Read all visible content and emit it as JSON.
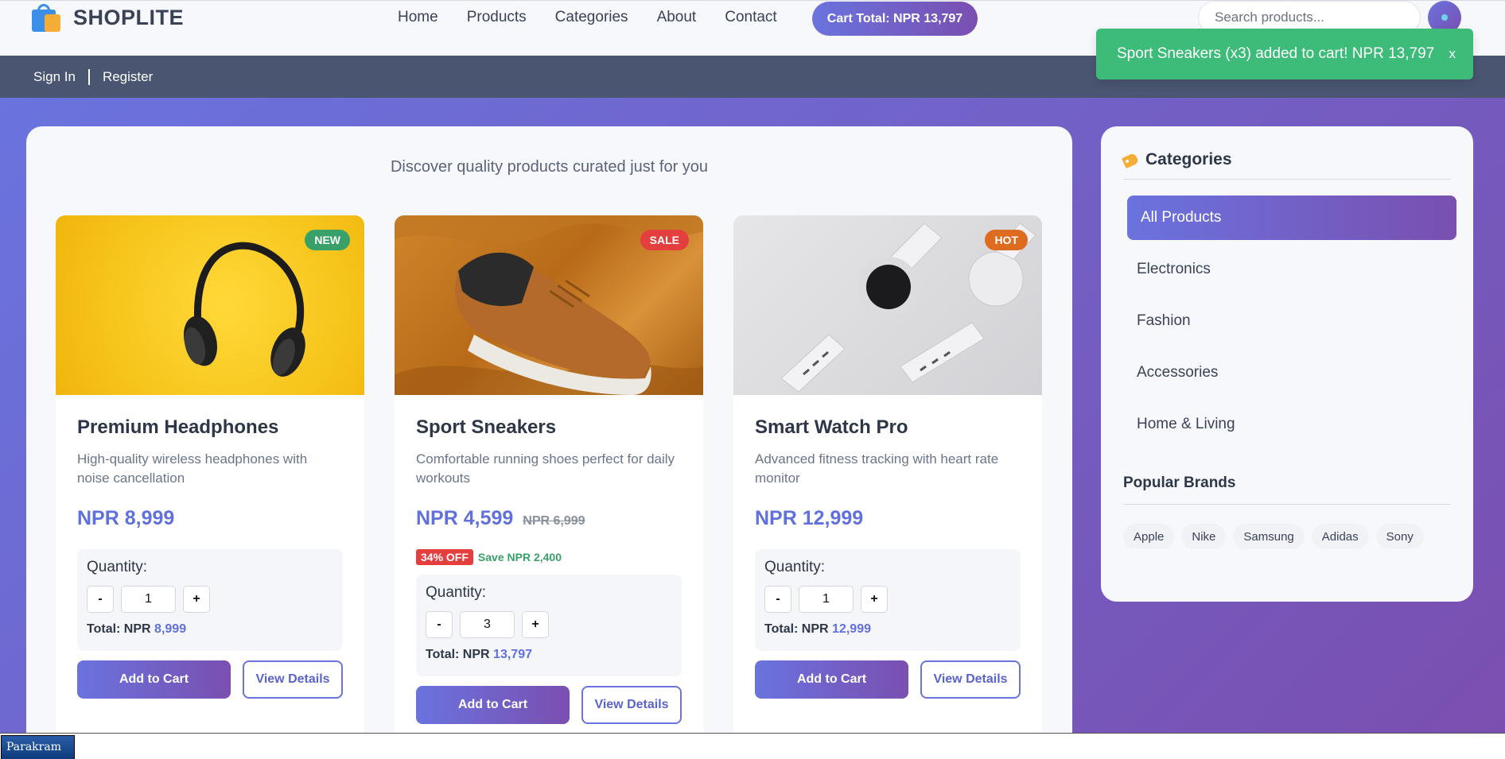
{
  "header": {
    "brand": "SHOPLITE",
    "nav": [
      "Home",
      "Products",
      "Categories",
      "About",
      "Contact"
    ],
    "cart_total": "Cart Total: NPR 13,797",
    "search_placeholder": "Search products..."
  },
  "auth": {
    "sign_in": "Sign In",
    "register": "Register"
  },
  "toast": {
    "message": "Sport Sneakers (x3) added to cart! NPR 13,797",
    "close": "x"
  },
  "main": {
    "tagline": "Discover quality products curated just for you",
    "products": [
      {
        "badge": "NEW",
        "badge_color": "#38a169",
        "title": "Premium Headphones",
        "description": "High-quality wireless headphones with noise cancellation",
        "price": "NPR 8,999",
        "quantity_label": "Quantity:",
        "minus": "-",
        "plus": "+",
        "quantity": "1",
        "total_label": "Total: NPR",
        "total_value": "8,999",
        "add_label": "Add to Cart",
        "view_label": "View Details"
      },
      {
        "badge": "SALE",
        "badge_color": "#e53e3e",
        "title": "Sport Sneakers",
        "description": "Comfortable running shoes perfect for daily workouts",
        "price": "NPR 4,599",
        "old_price": "NPR 6,999",
        "discount": "34% OFF",
        "save": "Save NPR 2,400",
        "quantity_label": "Quantity:",
        "minus": "-",
        "plus": "+",
        "quantity": "3",
        "total_label": "Total: NPR",
        "total_value": "13,797",
        "add_label": "Add to Cart",
        "view_label": "View Details"
      },
      {
        "badge": "HOT",
        "badge_color": "#dd6b20",
        "title": "Smart Watch Pro",
        "description": "Advanced fitness tracking with heart rate monitor",
        "price": "NPR 12,999",
        "quantity_label": "Quantity:",
        "minus": "-",
        "plus": "+",
        "quantity": "1",
        "total_label": "Total: NPR",
        "total_value": "12,999",
        "add_label": "Add to Cart",
        "view_label": "View Details"
      }
    ]
  },
  "sidebar": {
    "title": "Categories",
    "categories": [
      "All Products",
      "Electronics",
      "Fashion",
      "Accessories",
      "Home & Living"
    ],
    "brands_title": "Popular Brands",
    "brands": [
      "Apple",
      "Nike",
      "Samsung",
      "Adidas",
      "Sony"
    ]
  },
  "taskbar": {
    "label": "Parakram"
  },
  "colors": {
    "accent_start": "#6a73de",
    "accent_end": "#7a4fb0",
    "success": "#3dbb78"
  }
}
